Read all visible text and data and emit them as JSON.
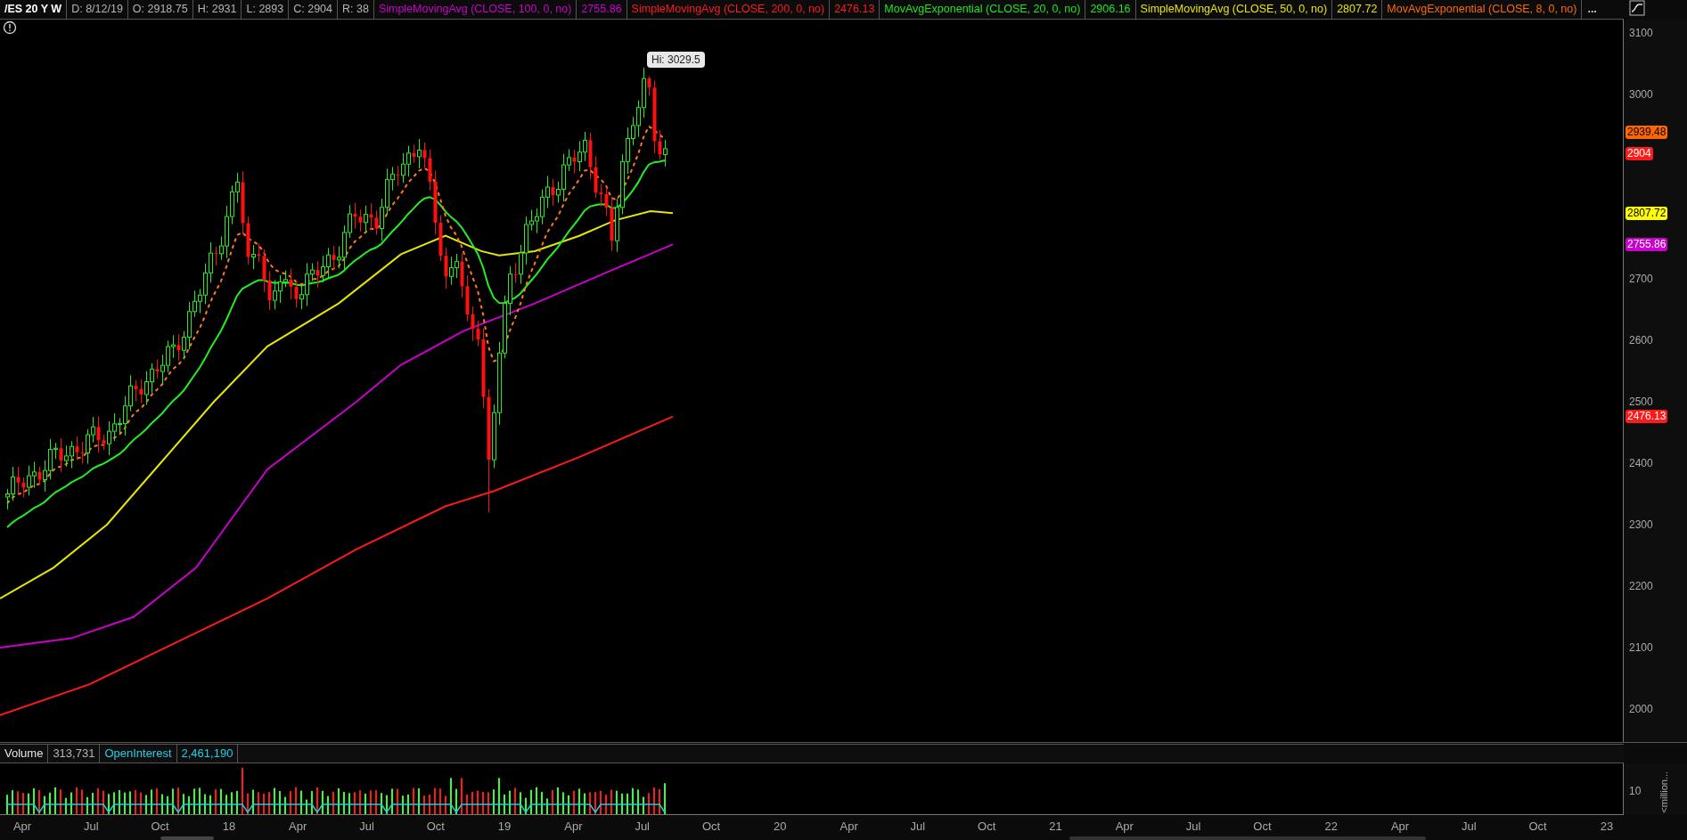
{
  "header": {
    "symbol": "/ES 20 Y W",
    "fields": [
      {
        "text": "D: 8/12/19",
        "color": "#b4b4b4"
      },
      {
        "text": "O: 2918.75",
        "color": "#b4b4b4"
      },
      {
        "text": "H: 2931",
        "color": "#b4b4b4"
      },
      {
        "text": "L: 2893",
        "color": "#b4b4b4"
      },
      {
        "text": "C: 2904",
        "color": "#b4b4b4"
      },
      {
        "text": "R: 38",
        "color": "#b4b4b4"
      },
      {
        "text": "SimpleMovingAvg (CLOSE, 100, 0, no)",
        "color": "#cc00cc"
      },
      {
        "text": "2755.86",
        "color": "#cc00cc"
      },
      {
        "text": "SimpleMovingAvg (CLOSE, 200, 0, no)",
        "color": "#ff1a1a"
      },
      {
        "text": "2476.13",
        "color": "#ff1a1a"
      },
      {
        "text": "MovAvgExponential (CLOSE, 20, 0, no)",
        "color": "#1ee61e"
      },
      {
        "text": "2906.16",
        "color": "#1ee61e"
      },
      {
        "text": "SimpleMovingAvg (CLOSE, 50, 0, no)",
        "color": "#e6e600"
      },
      {
        "text": "2807.72",
        "color": "#e6e600"
      },
      {
        "text": "MovAvgExponential (CLOSE, 8, 0, no)",
        "color": "#ff6a00"
      }
    ],
    "more": "..."
  },
  "price_chart": {
    "tooltip": "Hi: 3029.5",
    "y_ticks": [
      "3100",
      "3000",
      "2700",
      "2600",
      "2500",
      "2400",
      "2300",
      "2200",
      "2100",
      "2000"
    ],
    "price_badges": [
      {
        "text": "2939.48",
        "color": "#ff6600"
      },
      {
        "text": "2904",
        "color": "#ff1a1a"
      },
      {
        "text": "2807.72",
        "color": "#ffff00"
      },
      {
        "text": "2755.86",
        "color": "#cc00cc"
      },
      {
        "text": "2476.13",
        "color": "#ff1a1a"
      }
    ]
  },
  "volume_panel": {
    "fields": [
      {
        "text": "Volume",
        "color": "#e6e6e6"
      },
      {
        "text": "313,731",
        "color": "#b4b4b4"
      },
      {
        "text": "OpenInterest",
        "color": "#1ed2e6"
      },
      {
        "text": "2,461,190",
        "color": "#1ed2e6"
      }
    ],
    "y_tick": "10",
    "unit": "<million..."
  },
  "x_axis": [
    "Apr",
    "Jul",
    "Oct",
    "18",
    "Apr",
    "Jul",
    "Oct",
    "19",
    "Apr",
    "Jul",
    "Oct",
    "20",
    "Apr",
    "Jul",
    "Oct",
    "21",
    "Apr",
    "Jul",
    "Oct",
    "22",
    "Apr",
    "Jul",
    "Oct",
    "23"
  ]
}
